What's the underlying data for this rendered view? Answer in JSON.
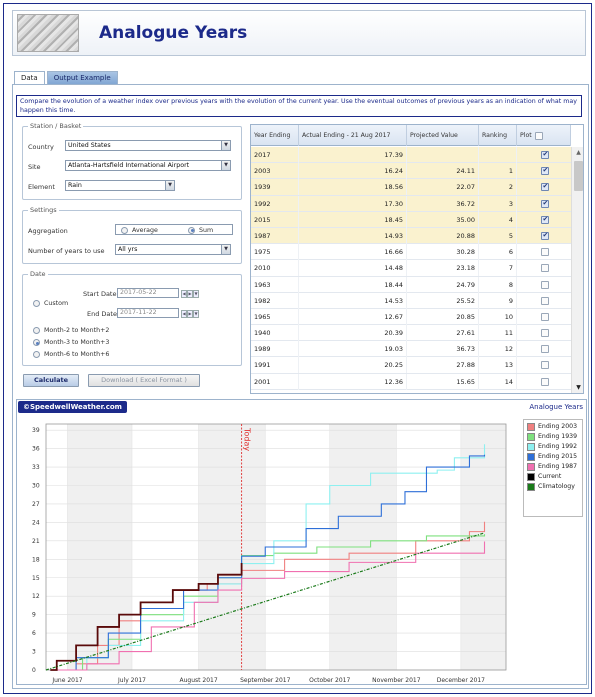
{
  "app": {
    "title": "Analogue Years"
  },
  "tabs": [
    {
      "label": "Data",
      "active": true
    },
    {
      "label": "Output Example",
      "active": false
    }
  ],
  "description": "Compare the evolution of a weather index over previous years with the evolution of the current year. Use the eventual outcomes of previous years as an indication of what may happen this time.",
  "station": {
    "legend": "Station / Basket",
    "country_label": "Country",
    "country_value": "United States",
    "site_label": "Site",
    "site_value": "Atlanta-Hartsfield International Airport",
    "element_label": "Element",
    "element_value": "Rain"
  },
  "settings": {
    "legend": "Settings",
    "aggregation_label": "Aggregation",
    "aggregation_options": [
      "Average",
      "Sum"
    ],
    "aggregation_selected": "Sum",
    "years_label": "Number of years to use",
    "years_value": "All yrs"
  },
  "date": {
    "legend": "Date",
    "custom_label": "Custom",
    "start_label": "Start Date",
    "start_value": "2017-05-22",
    "end_label": "End Date",
    "end_value": "2017-11-22",
    "options": [
      "Month-2 to Month+2",
      "Month-3 to Month+3",
      "Month-6 to Month+6"
    ],
    "selected": "Month-3 to Month+3"
  },
  "buttons": {
    "calculate": "Calculate",
    "download": "Download ( Excel Format )"
  },
  "table": {
    "headers": [
      "Year Ending",
      "Actual Ending - 21 Aug 2017",
      "Projected Value",
      "Ranking",
      "Plot"
    ],
    "rows": [
      {
        "year": "2017",
        "actual": "17.39",
        "projected": "",
        "rank": "",
        "plot": true,
        "selected": true
      },
      {
        "year": "2003",
        "actual": "16.24",
        "projected": "24.11",
        "rank": "1",
        "plot": true,
        "selected": true
      },
      {
        "year": "1939",
        "actual": "18.56",
        "projected": "22.07",
        "rank": "2",
        "plot": true,
        "selected": true
      },
      {
        "year": "1992",
        "actual": "17.30",
        "projected": "36.72",
        "rank": "3",
        "plot": true,
        "selected": true
      },
      {
        "year": "2015",
        "actual": "18.45",
        "projected": "35.00",
        "rank": "4",
        "plot": true,
        "selected": true
      },
      {
        "year": "1987",
        "actual": "14.93",
        "projected": "20.88",
        "rank": "5",
        "plot": true,
        "selected": true
      },
      {
        "year": "1975",
        "actual": "16.66",
        "projected": "30.28",
        "rank": "6",
        "plot": false,
        "selected": false
      },
      {
        "year": "2010",
        "actual": "14.48",
        "projected": "23.18",
        "rank": "7",
        "plot": false,
        "selected": false
      },
      {
        "year": "1963",
        "actual": "18.44",
        "projected": "24.79",
        "rank": "8",
        "plot": false,
        "selected": false
      },
      {
        "year": "1982",
        "actual": "14.53",
        "projected": "25.52",
        "rank": "9",
        "plot": false,
        "selected": false
      },
      {
        "year": "1965",
        "actual": "12.67",
        "projected": "20.85",
        "rank": "10",
        "plot": false,
        "selected": false
      },
      {
        "year": "1940",
        "actual": "20.39",
        "projected": "27.61",
        "rank": "11",
        "plot": false,
        "selected": false
      },
      {
        "year": "1989",
        "actual": "19.03",
        "projected": "36.73",
        "rank": "12",
        "plot": false,
        "selected": false
      },
      {
        "year": "1991",
        "actual": "20.25",
        "projected": "27.88",
        "rank": "13",
        "plot": false,
        "selected": false
      },
      {
        "year": "2001",
        "actual": "12.36",
        "projected": "15.65",
        "rank": "14",
        "plot": false,
        "selected": false
      }
    ]
  },
  "chart_panel": {
    "brand": "©SpeedwellWeather.com",
    "caption": "Analogue Years",
    "today_label": "Today"
  },
  "chart_data": {
    "type": "line",
    "title": "",
    "xlabel": "",
    "ylabel": "",
    "x_ticks": [
      "June 2017",
      "July 2017",
      "August 2017",
      "September 2017",
      "October 2017",
      "November 2017",
      "December 2017"
    ],
    "x_tick_dates": [
      "2017-06-01",
      "2017-07-01",
      "2017-08-01",
      "2017-09-01",
      "2017-10-01",
      "2017-11-01",
      "2017-12-01"
    ],
    "xlim": [
      "2017-05-22",
      "2017-12-22"
    ],
    "ylim": [
      0,
      40
    ],
    "y_ticks": [
      0,
      3,
      6,
      9,
      12,
      15,
      18,
      21,
      24,
      27,
      30,
      33,
      36,
      39
    ],
    "today": "2017-08-21",
    "grid": true,
    "legend_position": "top-right",
    "series": [
      {
        "name": "Ending 2003",
        "color": "#f08080",
        "points": [
          [
            "2017-05-24",
            0
          ],
          [
            "2017-06-05",
            1
          ],
          [
            "2017-06-15",
            4
          ],
          [
            "2017-06-25",
            8
          ],
          [
            "2017-07-05",
            11
          ],
          [
            "2017-07-20",
            13
          ],
          [
            "2017-08-05",
            14
          ],
          [
            "2017-08-21",
            16.2
          ],
          [
            "2017-09-10",
            18
          ],
          [
            "2017-10-10",
            19
          ],
          [
            "2017-11-10",
            21
          ],
          [
            "2017-12-05",
            22.5
          ],
          [
            "2017-12-12",
            24.1
          ]
        ]
      },
      {
        "name": "Ending 1939",
        "color": "#7ee07e",
        "points": [
          [
            "2017-05-24",
            0
          ],
          [
            "2017-06-08",
            2
          ],
          [
            "2017-06-20",
            5
          ],
          [
            "2017-07-05",
            9
          ],
          [
            "2017-07-25",
            12
          ],
          [
            "2017-08-10",
            15
          ],
          [
            "2017-08-21",
            18.6
          ],
          [
            "2017-09-05",
            19
          ],
          [
            "2017-09-25",
            20
          ],
          [
            "2017-10-20",
            21
          ],
          [
            "2017-11-15",
            21.8
          ],
          [
            "2017-12-12",
            22.1
          ]
        ]
      },
      {
        "name": "Ending 1992",
        "color": "#8ef0f0",
        "points": [
          [
            "2017-05-24",
            0
          ],
          [
            "2017-06-10",
            2
          ],
          [
            "2017-06-20",
            4
          ],
          [
            "2017-07-05",
            8
          ],
          [
            "2017-07-25",
            11
          ],
          [
            "2017-08-10",
            14
          ],
          [
            "2017-08-21",
            17.3
          ],
          [
            "2017-09-05",
            21
          ],
          [
            "2017-09-20",
            27
          ],
          [
            "2017-10-01",
            30
          ],
          [
            "2017-10-20",
            32
          ],
          [
            "2017-11-20",
            32.5
          ],
          [
            "2017-11-28",
            34.5
          ],
          [
            "2017-12-12",
            36.7
          ]
        ]
      },
      {
        "name": "Ending 2015",
        "color": "#2e6fd8",
        "points": [
          [
            "2017-05-24",
            0
          ],
          [
            "2017-06-05",
            2
          ],
          [
            "2017-06-20",
            6
          ],
          [
            "2017-07-05",
            10
          ],
          [
            "2017-07-25",
            13
          ],
          [
            "2017-08-10",
            15
          ],
          [
            "2017-08-21",
            18.5
          ],
          [
            "2017-09-01",
            20
          ],
          [
            "2017-09-20",
            23
          ],
          [
            "2017-10-05",
            25
          ],
          [
            "2017-10-25",
            27
          ],
          [
            "2017-11-05",
            29
          ],
          [
            "2017-11-15",
            33
          ],
          [
            "2017-12-05",
            34.8
          ],
          [
            "2017-12-12",
            35
          ]
        ]
      },
      {
        "name": "Ending 1987",
        "color": "#f070b0",
        "points": [
          [
            "2017-05-24",
            0
          ],
          [
            "2017-06-10",
            1
          ],
          [
            "2017-06-25",
            3
          ],
          [
            "2017-07-10",
            7
          ],
          [
            "2017-07-30",
            11
          ],
          [
            "2017-08-10",
            13
          ],
          [
            "2017-08-21",
            14.9
          ],
          [
            "2017-09-10",
            16
          ],
          [
            "2017-10-10",
            17.5
          ],
          [
            "2017-11-10",
            19
          ],
          [
            "2017-12-12",
            20.9
          ]
        ]
      },
      {
        "name": "Current",
        "color": "#000000",
        "points": [
          [
            "2017-05-24",
            0
          ],
          [
            "2017-05-27",
            1.5
          ],
          [
            "2017-06-05",
            4
          ],
          [
            "2017-06-15",
            7
          ],
          [
            "2017-06-25",
            9
          ],
          [
            "2017-07-05",
            11
          ],
          [
            "2017-07-20",
            13
          ],
          [
            "2017-08-01",
            14
          ],
          [
            "2017-08-10",
            15.5
          ],
          [
            "2017-08-21",
            17.4
          ]
        ]
      },
      {
        "name": "Climatology",
        "color": "#1a7a1a",
        "points": [
          [
            "2017-05-22",
            0
          ],
          [
            "2017-12-12",
            22.3
          ]
        ]
      }
    ]
  }
}
